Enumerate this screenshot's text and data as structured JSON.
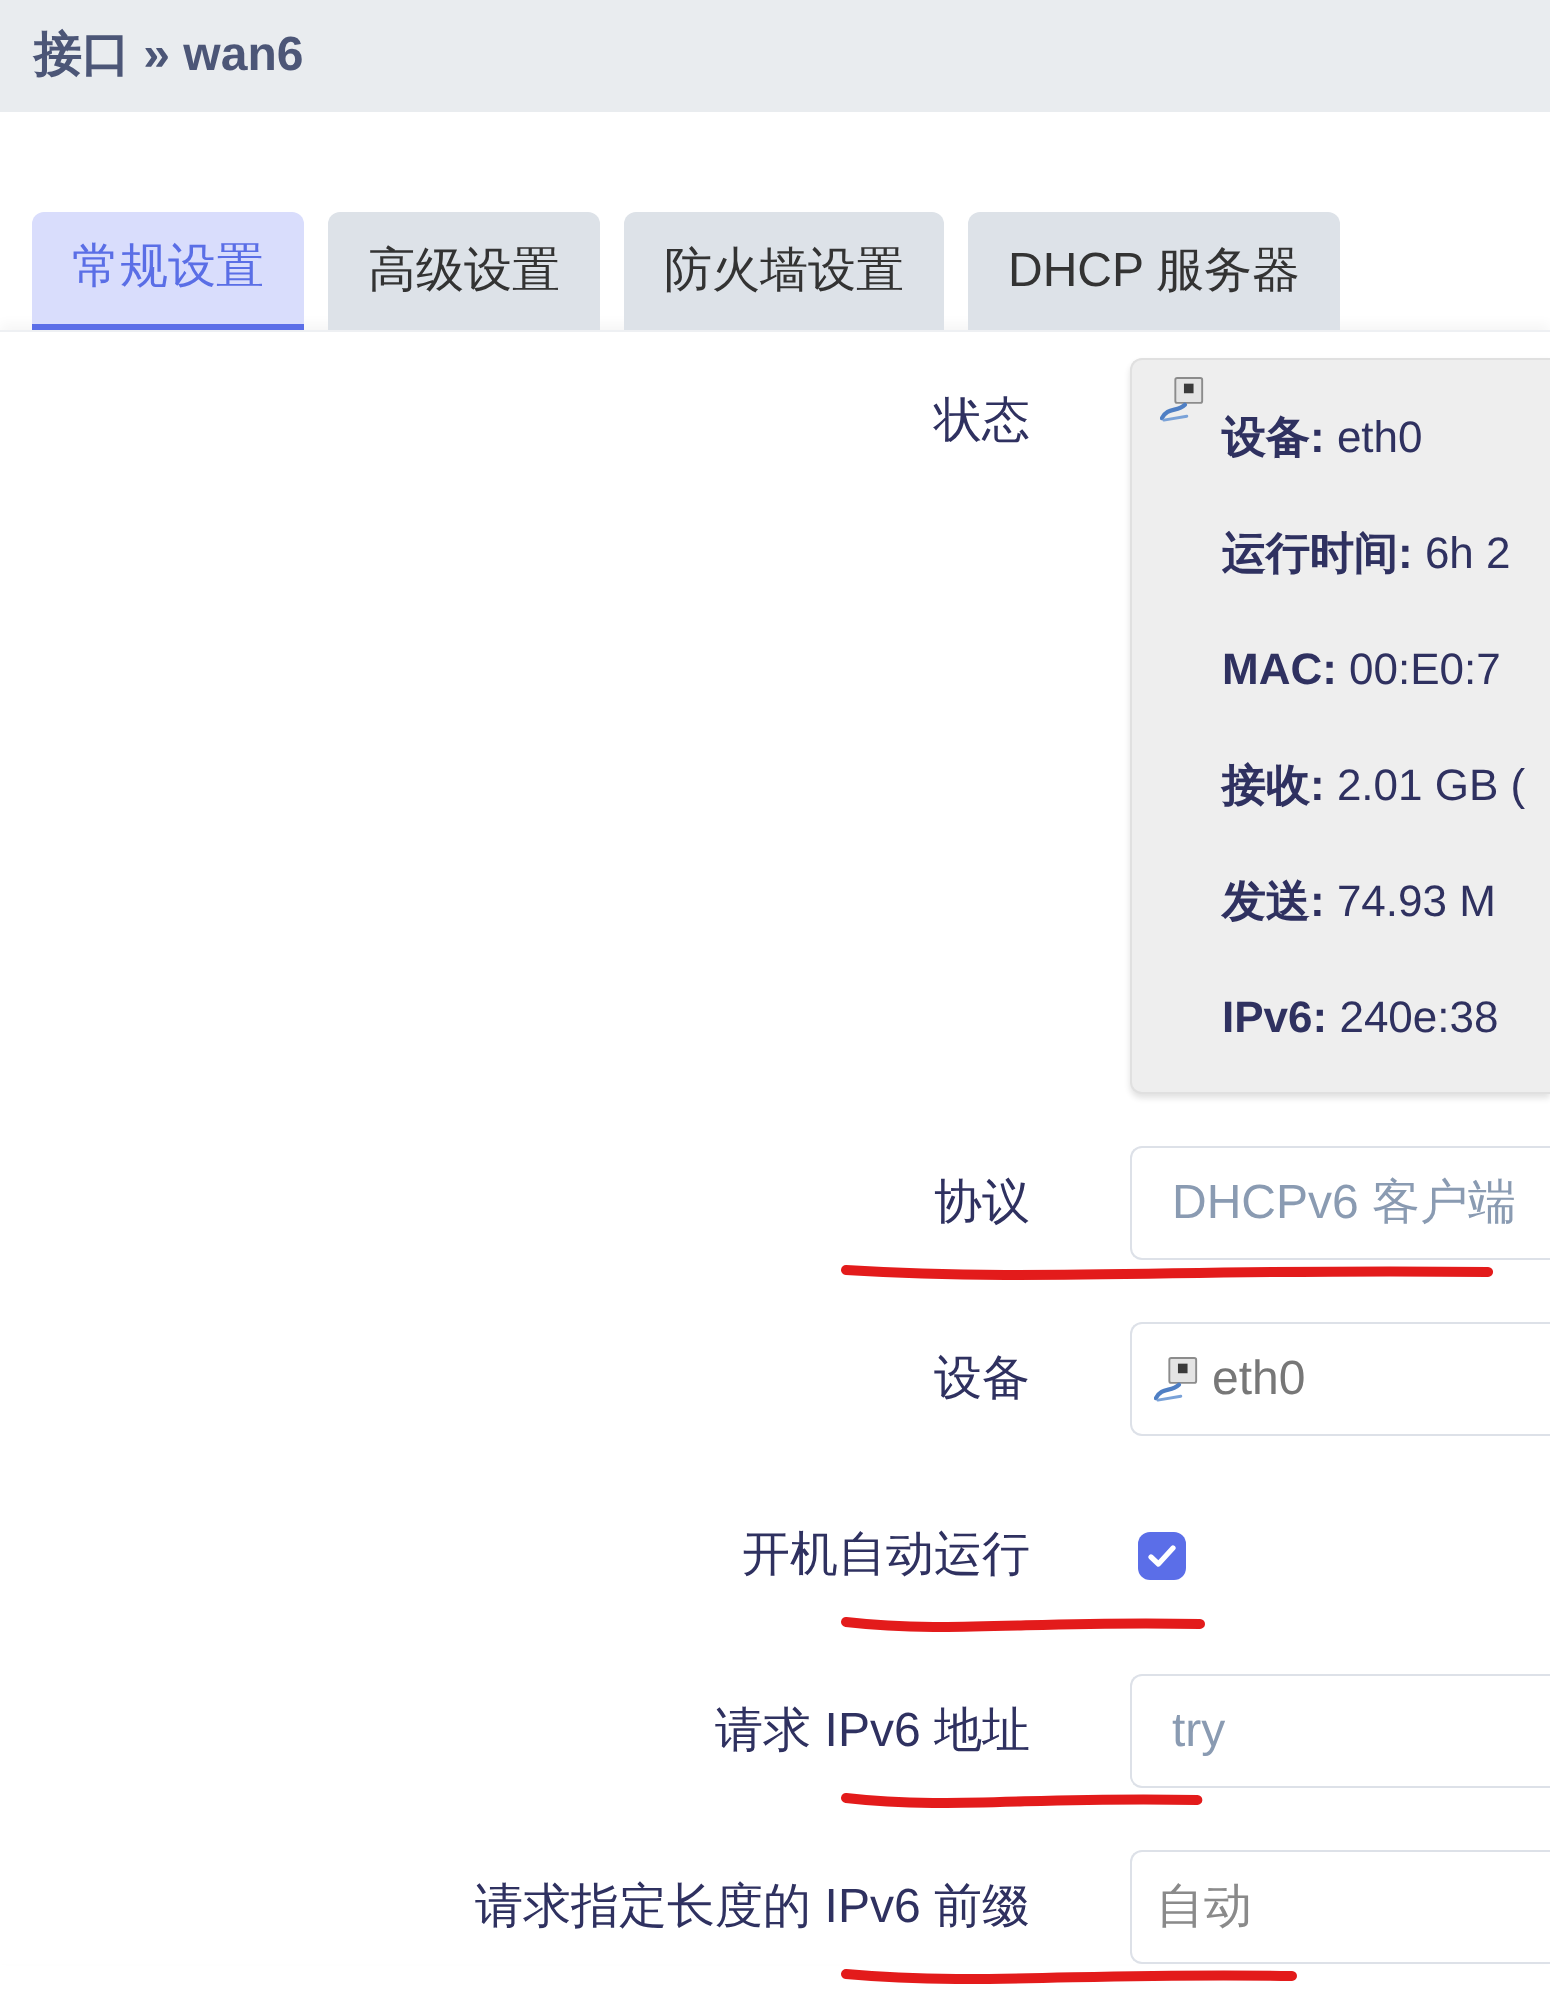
{
  "header": {
    "title": "接口 » wan6"
  },
  "tabs": [
    {
      "label": "常规设置",
      "selected": true
    },
    {
      "label": "高级设置",
      "selected": false
    },
    {
      "label": "防火墙设置",
      "selected": false
    },
    {
      "label": "DHCP 服务器",
      "selected": false
    }
  ],
  "status": {
    "label": "状态",
    "lines": [
      {
        "label": "设备:",
        "value": "eth0"
      },
      {
        "label": "运行时间:",
        "value": "6h 2"
      },
      {
        "label": "MAC:",
        "value": "00:E0:7"
      },
      {
        "label": "接收:",
        "value": "2.01 GB ("
      },
      {
        "label": "发送:",
        "value": "74.93 M"
      },
      {
        "label": "IPv6:",
        "value": "240e:38"
      }
    ]
  },
  "fields": [
    {
      "kind": "select",
      "label": "协议",
      "value": "DHCPv6 客户端",
      "underlined": true
    },
    {
      "kind": "device",
      "label": "设备",
      "value": "eth0",
      "underlined": false
    },
    {
      "kind": "checkbox",
      "label": "开机自动运行",
      "checked": true,
      "underlined": true
    },
    {
      "kind": "select",
      "label": "请求 IPv6 地址",
      "value": "try",
      "underlined": true
    },
    {
      "kind": "text",
      "label": "请求指定长度的 IPv6 前缀",
      "placeholder": "自动",
      "underlined": true
    }
  ]
}
